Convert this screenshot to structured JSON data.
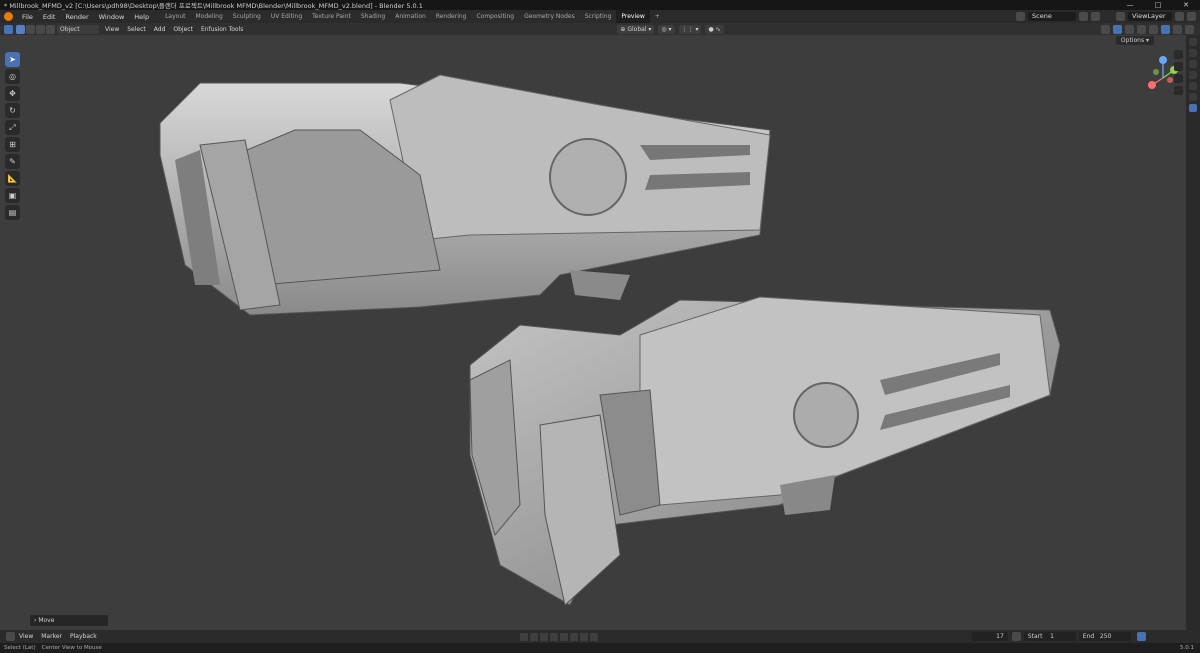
{
  "window": {
    "title": "* Millbrook_MFMD_v2 [C:\\Users\\pdh98\\Desktop\\플랜더 프로젝트\\Millbrook MFMD\\Blender\\Millbrook_MFMD_v2.blend] - Blender 5.0.1"
  },
  "menubar": {
    "menus": [
      "File",
      "Edit",
      "Render",
      "Window",
      "Help"
    ],
    "workspaces": [
      "Layout",
      "Modeling",
      "Sculpting",
      "UV Editing",
      "Texture Paint",
      "Shading",
      "Animation",
      "Rendering",
      "Compositing",
      "Geometry Nodes",
      "Scripting",
      "Preview"
    ],
    "active_workspace": "Preview",
    "scene": "Scene",
    "view_layer": "ViewLayer"
  },
  "header": {
    "mode": "Object Mode",
    "menus": [
      "View",
      "Select",
      "Add",
      "Object",
      "Enfusion Tools"
    ],
    "transform_orientation": "Global",
    "options_label": "Options"
  },
  "toolbar": {
    "tools": [
      "select-icon",
      "cursor-icon",
      "move-icon",
      "rotate-icon",
      "scale-icon",
      "transform-icon",
      "annotate-icon",
      "measure-icon",
      "add-cube-icon",
      "add-cube-alt-icon"
    ]
  },
  "viewport": {
    "last_operator": "Move"
  },
  "timeline": {
    "menus": [
      "View",
      "Marker",
      "Playback"
    ],
    "current_frame": "17",
    "start_label": "Start",
    "start": "1",
    "end_label": "End",
    "end": "250"
  },
  "statusbar": {
    "hint_left": "Select (Lat)",
    "hint_center": "Center View to Mouse",
    "version": "5.0.1"
  },
  "colors": {
    "accent": "#4772b3",
    "viewport_bg": "#3d3d3d",
    "blender_orange": "#e87d0d"
  }
}
